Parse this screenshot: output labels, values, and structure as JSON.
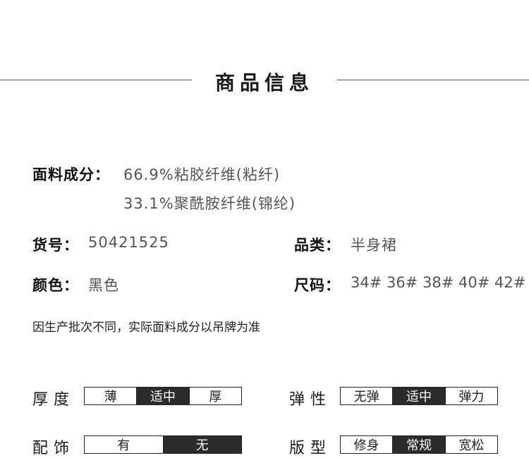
{
  "header": {
    "title": "商品信息"
  },
  "material": {
    "label": "面料成分：",
    "line1": "66.9%粘胶纤维(粘纤)",
    "line2": "33.1%聚酰胺纤维(锦纶)"
  },
  "item_no": {
    "label": "货号：",
    "value": "50421525"
  },
  "category": {
    "label": "品类：",
    "value": "半身裙"
  },
  "color": {
    "label": "颜色：",
    "value": "黑色"
  },
  "size": {
    "label": "尺码：",
    "value": "34# 36# 38# 40# 42#"
  },
  "note": "因生产批次不同，实际面料成分以吊牌为准",
  "scales": {
    "thickness": {
      "label": "厚度",
      "options": [
        "薄",
        "适中",
        "厚"
      ],
      "selected": "适中"
    },
    "elasticity": {
      "label": "弹性",
      "options": [
        "无弹",
        "适中",
        "弹力"
      ],
      "selected": "适中"
    },
    "accessory": {
      "label": "配饰",
      "options": [
        "有",
        "无"
      ],
      "selected": "无"
    },
    "fit": {
      "label": "版型",
      "options": [
        "修身",
        "常规",
        "宽松"
      ],
      "selected": "常规"
    }
  },
  "colors": {
    "active_segment": "#2b2b2b",
    "divider": "#555555"
  }
}
